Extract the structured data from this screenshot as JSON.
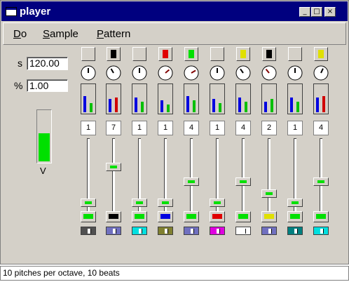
{
  "window": {
    "title": "player"
  },
  "titlebar_buttons": [
    {
      "name": "minimize-button",
      "glyph": "_"
    },
    {
      "name": "maximize-button",
      "glyph": "□"
    },
    {
      "name": "close-button",
      "glyph": "×"
    }
  ],
  "menu": [
    {
      "label": "Do",
      "accel": "D"
    },
    {
      "label": "Sample",
      "accel": "S"
    },
    {
      "label": "Pattern",
      "accel": "P"
    }
  ],
  "controls": {
    "speed_label": "s",
    "speed_value": "120.00",
    "percent_label": "%",
    "percent_value": "1.00",
    "volume_label": "V",
    "volume_level": 0.55,
    "volume_color": "#00e000"
  },
  "channels": [
    {
      "btn": "#d4d0c8",
      "knob": 0,
      "b1": 0.55,
      "b2": 0.3,
      "c2": "#00c000",
      "number": "1",
      "slider": 0.92,
      "btm": "#00e000",
      "sw": "#505050"
    },
    {
      "btn": "#000000",
      "knob": -30,
      "b1": 0.45,
      "b2": 0.5,
      "c2": "#d00000",
      "number": "7",
      "slider": 0.37,
      "btm": "#000000",
      "sw": "#7070c0"
    },
    {
      "btn": "#d4d0c8",
      "knob": 0,
      "b1": 0.5,
      "b2": 0.35,
      "c2": "#00c000",
      "number": "1",
      "slider": 0.92,
      "btm": "#00e000",
      "sw": "#00e0e0"
    },
    {
      "btn": "#e00000",
      "knob": 50,
      "b1": 0.4,
      "b2": 0.25,
      "c2": "#00c000",
      "number": "1",
      "slider": 0.92,
      "btm": "#0000e0",
      "sw": "#808030"
    },
    {
      "btn": "#00e000",
      "knob": 60,
      "b1": 0.55,
      "b2": 0.4,
      "c2": "#00c000",
      "number": "4",
      "slider": 0.6,
      "btm": "#00e000",
      "sw": "#7070c0"
    },
    {
      "btn": "#d4d0c8",
      "knob": 0,
      "b1": 0.45,
      "b2": 0.3,
      "c2": "#00c000",
      "number": "1",
      "slider": 0.92,
      "btm": "#e00000",
      "sw": "#e000e0"
    },
    {
      "btn": "#e0e000",
      "knob": -35,
      "b1": 0.5,
      "b2": 0.35,
      "c2": "#00c000",
      "number": "4",
      "slider": 0.6,
      "btm": "#00e000",
      "sw": "#ffffff"
    },
    {
      "btn": "#000000",
      "knob": -40,
      "b1": 0.35,
      "b2": 0.45,
      "c2": "#00c000",
      "number": "2",
      "slider": 0.78,
      "btm": "#e0e000",
      "sw": "#7070c0"
    },
    {
      "btn": "#d4d0c8",
      "knob": 0,
      "b1": 0.5,
      "b2": 0.35,
      "c2": "#00c000",
      "number": "1",
      "slider": 0.92,
      "btm": "#00e000",
      "sw": "#008080"
    },
    {
      "btn": "#e0e000",
      "knob": 25,
      "b1": 0.5,
      "b2": 0.55,
      "c2": "#d00000",
      "number": "4",
      "slider": 0.6,
      "btm": "#00e000",
      "sw": "#00e0e0"
    }
  ],
  "status": {
    "text": "10 pitches per octave, 10 beats"
  }
}
